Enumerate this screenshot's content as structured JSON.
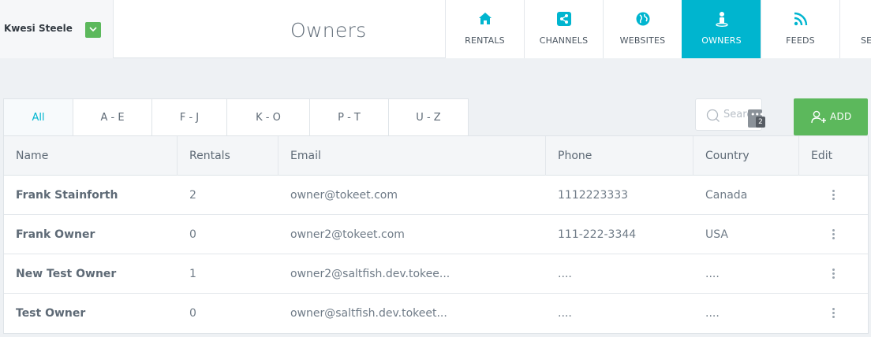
{
  "account": {
    "name": "Kwesi Steele"
  },
  "page": {
    "title": "Owners"
  },
  "nav": [
    {
      "label": "RENTALS",
      "icon": "home-icon"
    },
    {
      "label": "CHANNELS",
      "icon": "share-icon"
    },
    {
      "label": "WEBSITES",
      "icon": "globe-icon"
    },
    {
      "label": "OWNERS",
      "icon": "owner-icon",
      "active": true
    },
    {
      "label": "FEEDS",
      "icon": "rss-icon"
    },
    {
      "label": "SET",
      "icon": "settings-icon"
    }
  ],
  "filters": [
    "All",
    "A - E",
    "F - J",
    "K - O",
    "P - T",
    "U - Z"
  ],
  "search": {
    "placeholder": "Search"
  },
  "extension_badge": {
    "count": "2"
  },
  "add_button": {
    "label": "ADD"
  },
  "table": {
    "headers": [
      "Name",
      "Rentals",
      "Email",
      "Phone",
      "Country",
      "Edit"
    ],
    "rows": [
      {
        "name": "Frank Stainforth",
        "rentals": "2",
        "email": "owner@tokeet.com",
        "phone": "1112223333",
        "country": "Canada"
      },
      {
        "name": "Frank Owner",
        "rentals": "0",
        "email": "owner2@tokeet.com",
        "phone": "111-222-3344",
        "country": "USA"
      },
      {
        "name": "New Test Owner",
        "rentals": "1",
        "email": "owner2@saltfish.dev.tokee...",
        "phone": "....",
        "country": "...."
      },
      {
        "name": "Test Owner",
        "rentals": "0",
        "email": "owner@saltfish.dev.tokeet...",
        "phone": "....",
        "country": "...."
      }
    ]
  },
  "colors": {
    "accent": "#00b5cf",
    "add": "#5cb85c"
  }
}
